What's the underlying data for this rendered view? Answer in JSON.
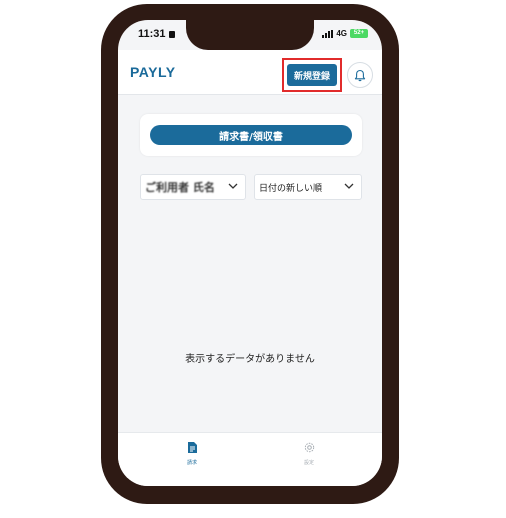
{
  "status_bar": {
    "time": "11:31",
    "network": "4G",
    "battery": "52+"
  },
  "header": {
    "logo": "PAYLY",
    "register_label": "新規登録"
  },
  "invoice_card": {
    "button_label": "請求書/領収書"
  },
  "filters": {
    "user_label": "ご利用者 氏名",
    "sort_label": "日付の新しい順"
  },
  "main": {
    "empty_message": "表示するデータがありません"
  },
  "tabbar": {
    "items": [
      {
        "label": "請求"
      },
      {
        "label": "設定"
      }
    ]
  },
  "colors": {
    "primary": "#1b6b9b",
    "logo": "#1a6a9a",
    "highlight": "#e12b2b",
    "phone_frame": "#2e1a14"
  }
}
